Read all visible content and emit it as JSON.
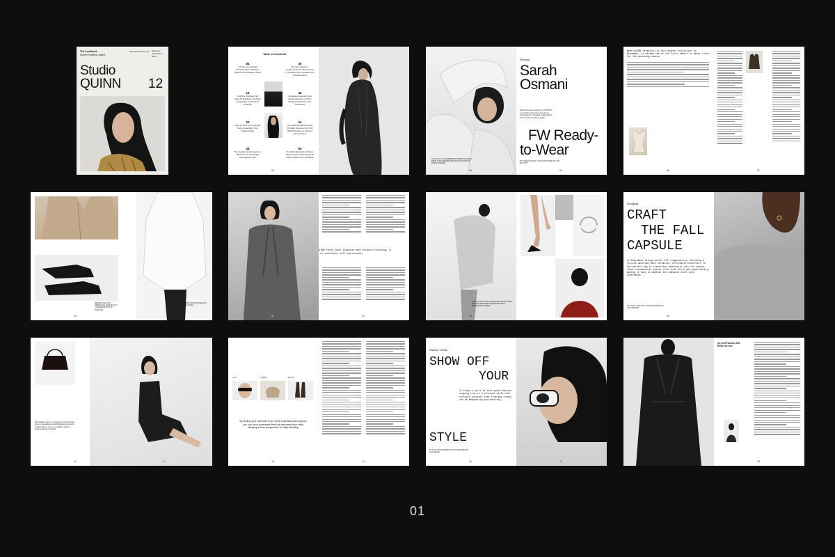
{
  "cover": {
    "label_lookbook": "The Lookbook",
    "label_sub": "Diverse Timeless Organic",
    "website": "www.studioquinn.com",
    "label_selected": "Selected Collections 2024",
    "title_line1": "Studio",
    "title_line2": "QUINN",
    "issue": "12"
  },
  "toc": {
    "heading": "Table of Contents",
    "items": [
      {
        "num": "04",
        "text": "A First Look at Sarah Osmani's New Collection: QUINN's FW Ready-to-Wear"
      },
      {
        "num": "14",
        "text": "Craft the Timeless Fall Capsule Wardrobe: Embrace Sustainable Approach to Dressing"
      },
      {
        "num": "23",
        "text": "How To Find Your Personal Style: Expanding Your Fashion Ethic"
      },
      {
        "num": "28",
        "text": "The Leather Jacket Season is Back: Find a Completely Reimagined Look"
      },
      {
        "num": "30",
        "text": "The Chic Attention: Contemporary Portfolio Stories In Transforming Innovation and Timeless Vision"
      },
      {
        "num": "42",
        "text": "Conscious Approach to a Creative Director of WCA: Bringing Expression with Leadership"
      },
      {
        "num": "54",
        "text": "The Splendid Behind Studio Portraits: Success From the Brand Because of Fashion Assured Story"
      },
      {
        "num": "60",
        "text": "The Minimalist Edit: Embrace Simple Anchor Embracing The Fall to Reflect Your Wardrobe"
      }
    ],
    "page_left": "02",
    "page_right": "03"
  },
  "feature": {
    "section": "Runway",
    "name_line1": "Sarah",
    "name_line2": "Osmani",
    "intro": "Sarah Osmani's runway for QUINN is a masterful showcase of opulence, channeling the timeless sophistication as the heart of Quinn's legacy.",
    "headline_line1": "FW Ready-",
    "headline_line2": "to-Wear",
    "byline": "BY SARAH MILLER / PHOTOGRAPHED BY ANA WALTON",
    "photo_caption": "LIGHT SILK & CASHMERE BOUNDED BLAZER & BARE SHOULDERED DRESS AND SHOES BY SARAH OSMANI",
    "page_left": "04",
    "page_right": "05",
    "body_start": "When QUINN revealed its Fall/Winter collection in November, it became one of the first labels to debut looks for the upcoming season.",
    "page_06": "06",
    "page_07": "07"
  },
  "row2": {
    "caption_a": "MERINO AND ANTI-WRINKLE BLAZER BY FLO-LA BRAND BOOTS BY ROSETTE",
    "caption_b": "THE WHITE BLOUSE PIECE BY STUDIO QUINN",
    "pull_quote": "In this collection, Sarah Osmani's approach to QUINN feels both timeless and forward-thinking, a tribute to the enduring spirit of confident self-expression.",
    "caption_c": "THIS COLLECTION SHOWCASES SCULPTURAL BOTANIC MATERIALS ELEVATED WITH BUSINESS BY QUINN",
    "shopping_section": "Shopping",
    "craft_line1": "CRAFT",
    "craft_line2": "THE FALL",
    "craft_line3": "CAPSULE",
    "craft_body": "As September brings milder fall temperatures, building a stylish wardrobe with versatile, affordable essentials is the perfect way to transition seamlessly into the season. These foundational pieces offer both style and practicality, making it easy to embrace the seasonal shift with confidence.",
    "craft_byline": "BY DIANE JACKSON / PHOTOGRAPHED BY ALEX BROWN",
    "pages": [
      "10",
      "11",
      "12",
      "13",
      "14",
      "15"
    ]
  },
  "row3": {
    "bag_caption": "The leather bag is a structured and functional piece: a versatile and sophisticated accessory crafted with an eye for versatility, without compromising on quality.",
    "eyewear_labels": [
      "CHIC",
      "CREAM",
      "BOOTS"
    ],
    "quote_center": "By finding your wardrobe to an a few essential week support, you can focus outerwear that truly represent your style, bringing a fresh perspective on daily dressing.",
    "trends_section": "Fashion Trends",
    "show_line1": "SHOW OFF",
    "show_line2": "YOUR",
    "show_line3": "STYLE",
    "show_body": "In today's world of fast-paced fashion, staying true to a personal style that reflects yourself than fleeting trends can be empowering and enduring.",
    "show_byline": "BY RUTH WOODWARD / PHOTOGRAPHED BY ANA LEONE",
    "look_title": "(21) Get Familiar With What You Like",
    "coat_caption": "AN ELEGANT BLACK LEATHER TRENCH COAT BY QUINN",
    "pages": [
      "16",
      "17",
      "18",
      "19",
      "20",
      "21",
      "22",
      "23"
    ]
  },
  "footer": {
    "caption": "01"
  }
}
